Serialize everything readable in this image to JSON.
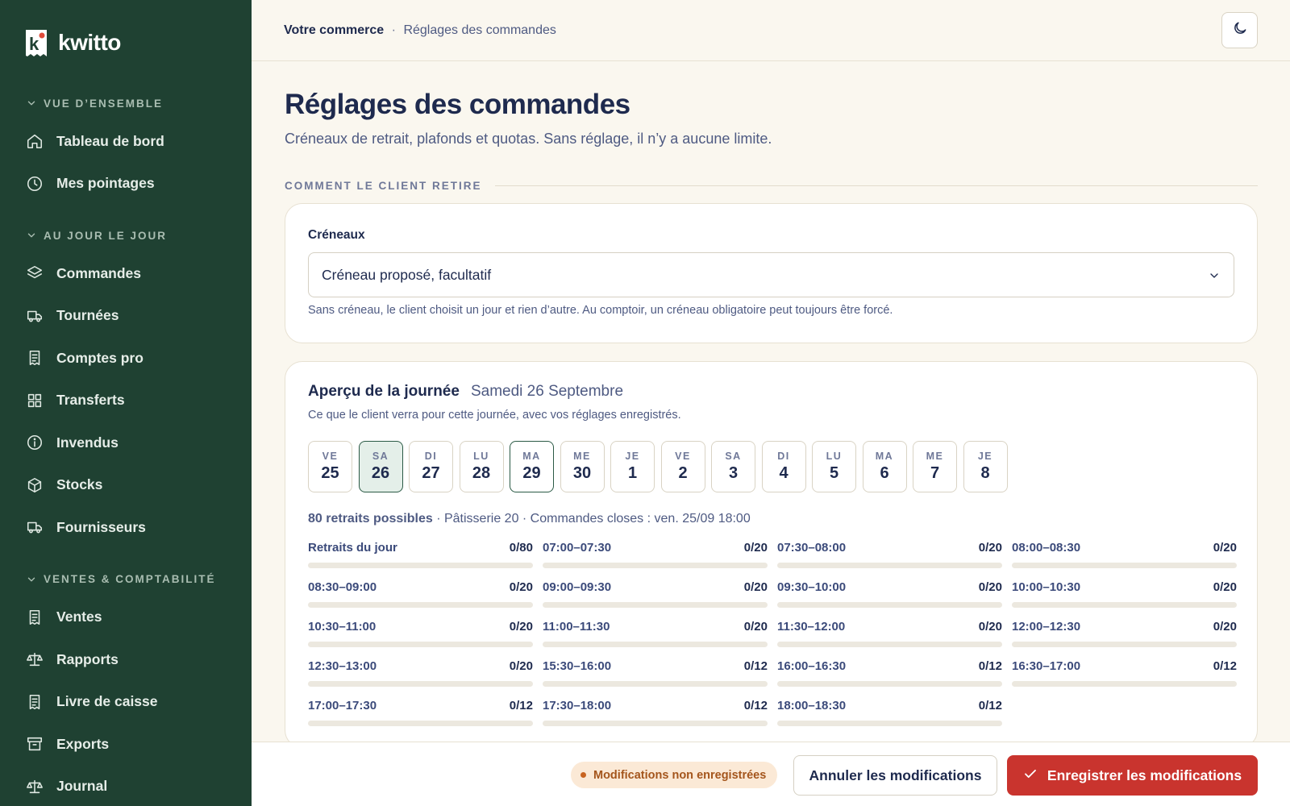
{
  "brand": {
    "name": "kwitto",
    "logo_letter": "k"
  },
  "sidebar": {
    "sections": [
      {
        "title": "VUE D’ENSEMBLE",
        "items": [
          {
            "label": "Tableau de bord",
            "icon": "home-icon"
          },
          {
            "label": "Mes pointages",
            "icon": "clock-icon"
          }
        ]
      },
      {
        "title": "AU JOUR LE JOUR",
        "items": [
          {
            "label": "Commandes",
            "icon": "layers-icon"
          },
          {
            "label": "Tournées",
            "icon": "truck-icon"
          },
          {
            "label": "Comptes pro",
            "icon": "receipt-icon"
          },
          {
            "label": "Transferts",
            "icon": "grid-icon"
          },
          {
            "label": "Invendus",
            "icon": "info-icon"
          },
          {
            "label": "Stocks",
            "icon": "box-icon"
          },
          {
            "label": "Fournisseurs",
            "icon": "truck-icon"
          }
        ]
      },
      {
        "title": "VENTES & COMPTABILITÉ",
        "items": [
          {
            "label": "Ventes",
            "icon": "receipt-icon"
          },
          {
            "label": "Rapports",
            "icon": "scale-icon"
          },
          {
            "label": "Livre de caisse",
            "icon": "receipt-icon"
          },
          {
            "label": "Exports",
            "icon": "archive-icon"
          },
          {
            "label": "Journal",
            "icon": "scale-icon"
          }
        ]
      }
    ]
  },
  "breadcrumb": {
    "root": "Votre commerce",
    "separator": "·",
    "current": "Réglages des commandes"
  },
  "theme_toggle": {
    "icon": "moon-icon"
  },
  "page": {
    "title": "Réglages des commandes",
    "subtitle": "Créneaux de retrait, plafonds et quotas. Sans réglage, il n’y a aucune limite."
  },
  "section_label": "COMMENT LE CLIENT RETIRE",
  "creneaux": {
    "label": "Créneaux",
    "selected": "Créneau proposé, facultatif",
    "hint": "Sans créneau, le client choisit un jour et rien d’autre. Au comptoir, un créneau obligatoire peut toujours être forcé."
  },
  "apercu": {
    "title": "Aperçu de la journée",
    "date": "Samedi 26 Septembre",
    "description": "Ce que le client verra pour cette journée, avec vos réglages enregistrés.",
    "days": [
      {
        "name": "VE",
        "num": "25",
        "state": "normal"
      },
      {
        "name": "SA",
        "num": "26",
        "state": "selected"
      },
      {
        "name": "DI",
        "num": "27",
        "state": "normal"
      },
      {
        "name": "LU",
        "num": "28",
        "state": "normal"
      },
      {
        "name": "MA",
        "num": "29",
        "state": "today"
      },
      {
        "name": "ME",
        "num": "30",
        "state": "normal"
      },
      {
        "name": "JE",
        "num": "1",
        "state": "normal"
      },
      {
        "name": "VE",
        "num": "2",
        "state": "normal"
      },
      {
        "name": "SA",
        "num": "3",
        "state": "normal"
      },
      {
        "name": "DI",
        "num": "4",
        "state": "normal"
      },
      {
        "name": "LU",
        "num": "5",
        "state": "normal"
      },
      {
        "name": "MA",
        "num": "6",
        "state": "normal"
      },
      {
        "name": "ME",
        "num": "7",
        "state": "normal"
      },
      {
        "name": "JE",
        "num": "8",
        "state": "normal"
      }
    ],
    "summary": {
      "strong": "80 retraits possibles",
      "rest": " · Pâtisserie 20 · Commandes closes : ven. 25/09 18:00"
    },
    "slots": [
      {
        "label": "Retraits du jour",
        "count": "0/80",
        "fill": 0
      },
      {
        "label": "07:00–07:30",
        "count": "0/20",
        "fill": 0
      },
      {
        "label": "07:30–08:00",
        "count": "0/20",
        "fill": 0
      },
      {
        "label": "08:00–08:30",
        "count": "0/20",
        "fill": 0
      },
      {
        "label": "08:30–09:00",
        "count": "0/20",
        "fill": 0
      },
      {
        "label": "09:00–09:30",
        "count": "0/20",
        "fill": 0
      },
      {
        "label": "09:30–10:00",
        "count": "0/20",
        "fill": 0
      },
      {
        "label": "10:00–10:30",
        "count": "0/20",
        "fill": 0
      },
      {
        "label": "10:30–11:00",
        "count": "0/20",
        "fill": 0
      },
      {
        "label": "11:00–11:30",
        "count": "0/20",
        "fill": 0
      },
      {
        "label": "11:30–12:00",
        "count": "0/20",
        "fill": 0
      },
      {
        "label": "12:00–12:30",
        "count": "0/20",
        "fill": 0
      },
      {
        "label": "12:30–13:00",
        "count": "0/20",
        "fill": 0
      },
      {
        "label": "15:30–16:00",
        "count": "0/12",
        "fill": 0
      },
      {
        "label": "16:00–16:30",
        "count": "0/12",
        "fill": 0
      },
      {
        "label": "16:30–17:00",
        "count": "0/12",
        "fill": 0
      },
      {
        "label": "17:00–17:30",
        "count": "0/12",
        "fill": 0
      },
      {
        "label": "17:30–18:00",
        "count": "0/12",
        "fill": 0
      },
      {
        "label": "18:00–18:30",
        "count": "0/12",
        "fill": 0
      }
    ]
  },
  "actions": {
    "unsaved": "Modifications non enregistrées",
    "cancel": "Annuler les modifications",
    "save": "Enregistrer les modifications"
  },
  "colors": {
    "sidebar_bg": "#1f4132",
    "accent_green": "#2b5a45",
    "save_red": "#c9342e",
    "unsaved_bg": "#fbe9d6",
    "text_navy": "#1e2a4e"
  }
}
